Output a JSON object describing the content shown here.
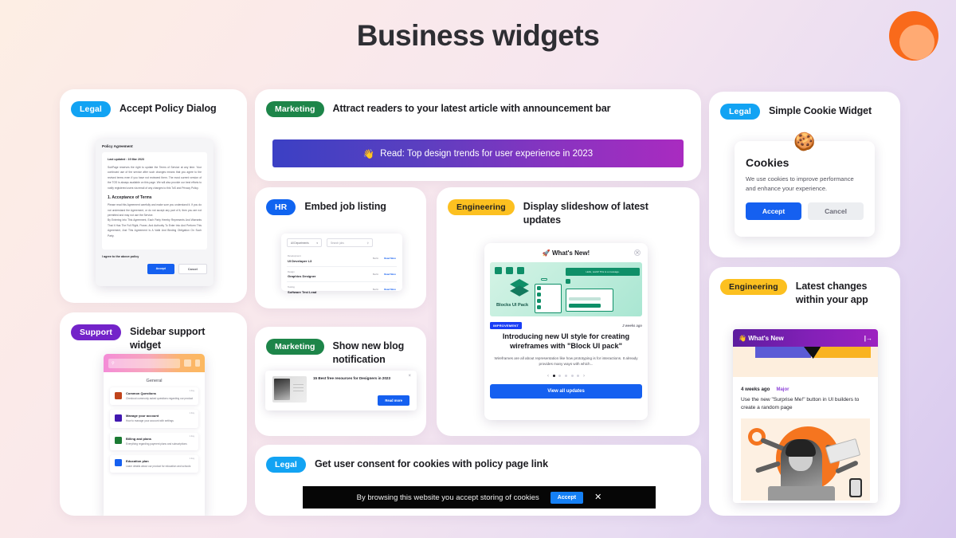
{
  "page": {
    "title": "Business widgets"
  },
  "logo": {
    "name": "orange-circles-logo",
    "outer_color": "#f96a1b",
    "inner_color": "#ffaa73"
  },
  "tags": {
    "legal": "Legal",
    "marketing": "Marketing",
    "hr": "HR",
    "engineering": "Engineering",
    "support": "Support"
  },
  "cards": {
    "accept_policy": {
      "tag": "Legal",
      "title": "Accept Policy Dialog",
      "dialog": {
        "heading": "Policy Agreement",
        "last_updated": "Last updated : 19 Mar 2023",
        "paragraph": "SubPage reserves the right to update the Terms of Service at any time. Your continued use of the service after such changes means that you agree to the revised terms even if you have not reviewed them. The most current version of the TOS is always available on this page. We will also provide our best efforts to notify registered users via email of any changes to this ToS and Privacy Policy.",
        "section_heading": "1. Acceptance of Terms",
        "section_paragraph_1": "Please read this Agreement carefully and make sure you understand it. If you do not understand the Agreement, or do not accept any part of it, then you are not permitted and may not use the Service.",
        "section_paragraph_2": "By Entering Into This Agreement, Each Party Hereby Represents And Warrants That It Has The Full Right, Power, And Authority To Enter Into And Perform This Agreement, And This Agreement Is A Valid And Binding Obligation On Such Party.",
        "agree_label": "I agree to the above policy",
        "accept_label": "Accept",
        "cancel_label": "Cancel"
      }
    },
    "announcement_bar": {
      "tag": "Marketing",
      "title": "Attract readers to your latest article with announcement bar",
      "bar": {
        "emoji": "👋",
        "text": "Read: Top design trends for user experience in 2023"
      }
    },
    "simple_cookie": {
      "tag": "Legal",
      "title": "Simple Cookie Widget",
      "widget": {
        "emoji": "🍪",
        "heading": "Cookies",
        "body": "We use cookies to improve performance and enhance your experience.",
        "accept_label": "Accept",
        "cancel_label": "Cancel"
      }
    },
    "job_listing": {
      "tag": "HR",
      "title": "Embed job listing",
      "panel": {
        "department_filter": "All Departments",
        "search_placeholder": "Search jobs",
        "more_label": "Read More",
        "jobs": [
          {
            "department": "Development",
            "title": "UI Developer L3",
            "location": "Berlin"
          },
          {
            "department": "Design",
            "title": "Graphics Designer",
            "location": "Berlin"
          },
          {
            "department": "Testing",
            "title": "Software Test Lead",
            "location": "Berlin"
          }
        ]
      }
    },
    "slideshow": {
      "tag": "Engineering",
      "title": "Display slideshow of latest updates",
      "widget": {
        "header_emoji": "🚀",
        "header": "What's New!",
        "hero_label": "Blocks UI Pack",
        "hero_toast": "Hello, world! This is a message.",
        "badge": "IMPROVEMENT",
        "timestamp": "2 weeks ago",
        "title": "Introducing new UI style for creating wireframes with \"Block UI pack\"",
        "description": "Wireframes are all about representation like how prototyping is for interactions. It already provides many ways with which...",
        "dot_count": 5,
        "active_dot": 1,
        "cta_label": "View all updates"
      }
    },
    "sidebar_support": {
      "tag": "Support",
      "title": "Sidebar support widget",
      "widget": {
        "search_placeholder": "",
        "section_label": "General",
        "items": [
          {
            "title": "Common Questions",
            "desc": "Checkout commonly asked questions regarding our product",
            "ago": "1 day",
            "color": "#c0441b"
          },
          {
            "title": "Manage your account",
            "desc": "How to manage your account with settings",
            "ago": "1 day",
            "color": "#4118b0"
          },
          {
            "title": "Billing and plans",
            "desc": "Everything regarding payment plans and subscriptions",
            "ago": "1 day",
            "color": "#1b7a33"
          },
          {
            "title": "Education plan",
            "desc": "Learn details about our product for education and schools",
            "ago": "1 day",
            "color": "#1560f0"
          }
        ]
      }
    },
    "blog_notification": {
      "tag": "Marketing",
      "title": "Show new blog notification",
      "widget": {
        "title": "15 Best free resources for Designers in 2023",
        "button_label": "Read more",
        "close_label": "×"
      }
    },
    "latest_changes": {
      "tag": "Engineering",
      "title": "Latest changes within your app",
      "widget": {
        "header_emoji": "👋",
        "header": "What's New",
        "collapse_icon": "|→",
        "timestamp": "4 weeks ago",
        "label": "Major",
        "body": "Use the new \"Surprise Me!\" button in UI builders to create a random page"
      }
    },
    "cookie_consent": {
      "tag": "Legal",
      "title": "Get user consent for cookies with policy page link",
      "bar": {
        "text": "By browsing this website you accept storing of cookies",
        "accept_label": "Accept",
        "close_label": "✕"
      }
    }
  }
}
